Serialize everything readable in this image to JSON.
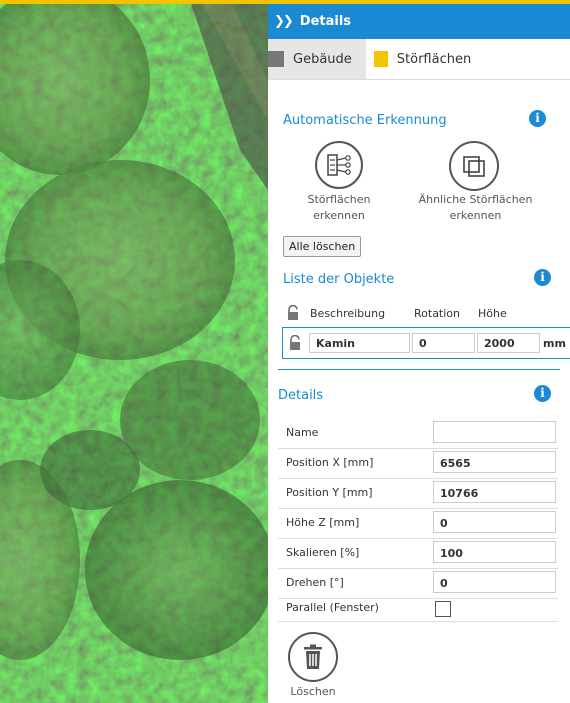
{
  "panel": {
    "title": "Details"
  },
  "tabs": [
    {
      "label": "Gebäude",
      "color": "#777777"
    },
    {
      "label": "Störflächen",
      "color": "#f5c400"
    }
  ],
  "auto_detect": {
    "title": "Automatische Erkennung",
    "btn1_line1": "Störflächen",
    "btn1_line2": "erkennen",
    "btn2_line1": "Ähnliche Störflächen",
    "btn2_line2": "erkennen",
    "clear_label": "Alle löschen"
  },
  "objects": {
    "title": "Liste der Objekte",
    "columns": {
      "description": "Beschreibung",
      "rotation": "Rotation",
      "height": "Höhe"
    },
    "rows": [
      {
        "description": "Kamin",
        "rotation": "0",
        "height": "2000",
        "unit": "mm"
      }
    ]
  },
  "details": {
    "title": "Details",
    "name_label": "Name",
    "name_value": "",
    "pos_x_label": "Position X [mm]",
    "pos_x_value": "6565",
    "pos_y_label": "Position Y [mm]",
    "pos_y_value": "10766",
    "height_z_label": "Höhe Z [mm]",
    "height_z_value": "0",
    "scale_label": "Skalieren [%]",
    "scale_value": "100",
    "rotate_label": "Drehen [°]",
    "rotate_value": "0",
    "parallel_label": "Parallel (Fenster)",
    "delete_label": "Löschen"
  },
  "colors": {
    "accent": "#1a8ad4",
    "highlight": "#f2c400"
  }
}
